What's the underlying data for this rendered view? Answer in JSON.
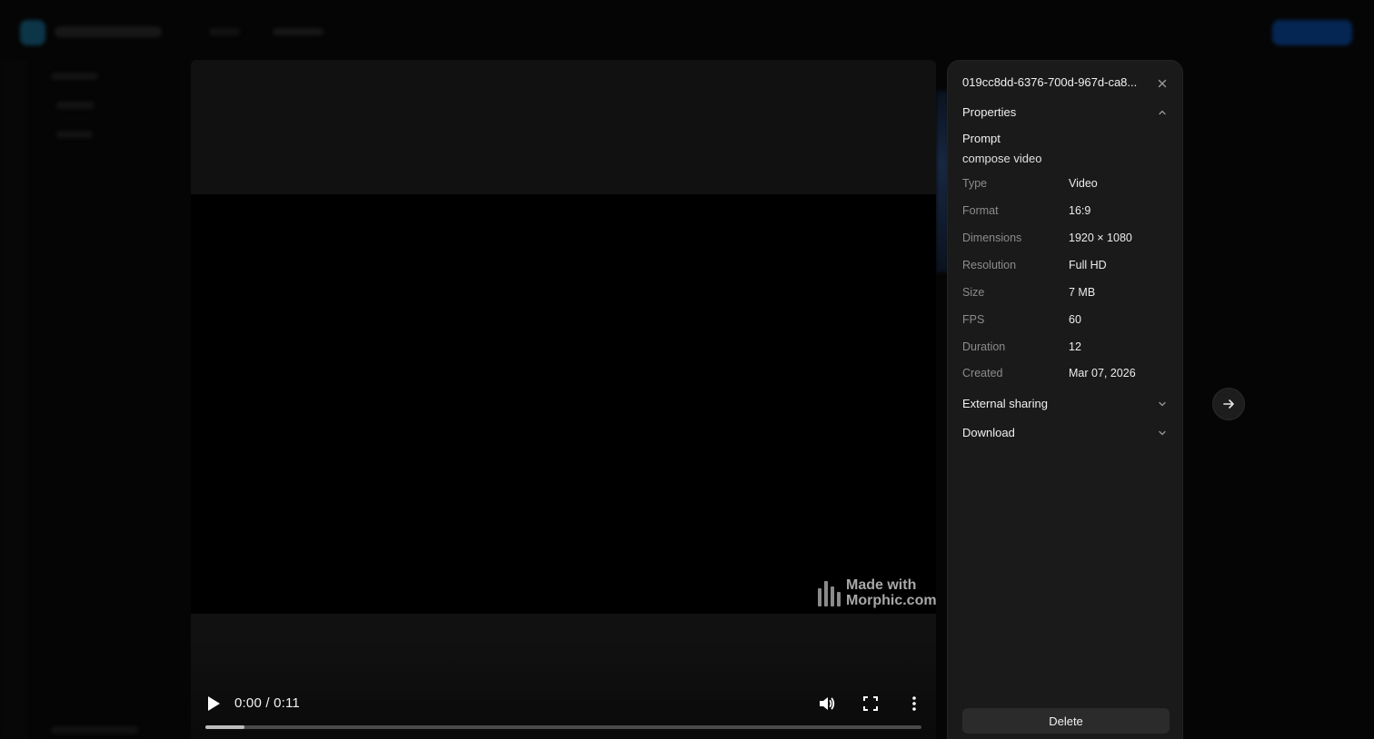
{
  "player": {
    "time_display": "0:00 / 0:11",
    "progress": 0.055,
    "watermark_line1": "Made with",
    "watermark_line2": "Morphic.com",
    "icons": [
      "play-icon",
      "volume-icon",
      "fullscreen-icon",
      "more-vertical-icon"
    ]
  },
  "panel": {
    "file_name": "019cc8dd-6376-700d-967d-ca8...",
    "properties_title": "Properties",
    "prompt_label": "Prompt",
    "prompt_value": "compose video",
    "properties": [
      {
        "key": "Type",
        "value": "Video"
      },
      {
        "key": "Format",
        "value": "16:9"
      },
      {
        "key": "Dimensions",
        "value": "1920 × 1080"
      },
      {
        "key": "Resolution",
        "value": "Full HD"
      },
      {
        "key": "Size",
        "value": "7 MB"
      },
      {
        "key": "FPS",
        "value": "60"
      },
      {
        "key": "Duration",
        "value": "12"
      },
      {
        "key": "Created",
        "value": "Mar 07, 2026"
      }
    ],
    "external_sharing_title": "External sharing",
    "download_title": "Download",
    "delete_label": "Delete"
  },
  "colors": {
    "panel_bg": "#1a1a1a",
    "page_bg": "#050505",
    "accent_blue": "#062a5c"
  }
}
